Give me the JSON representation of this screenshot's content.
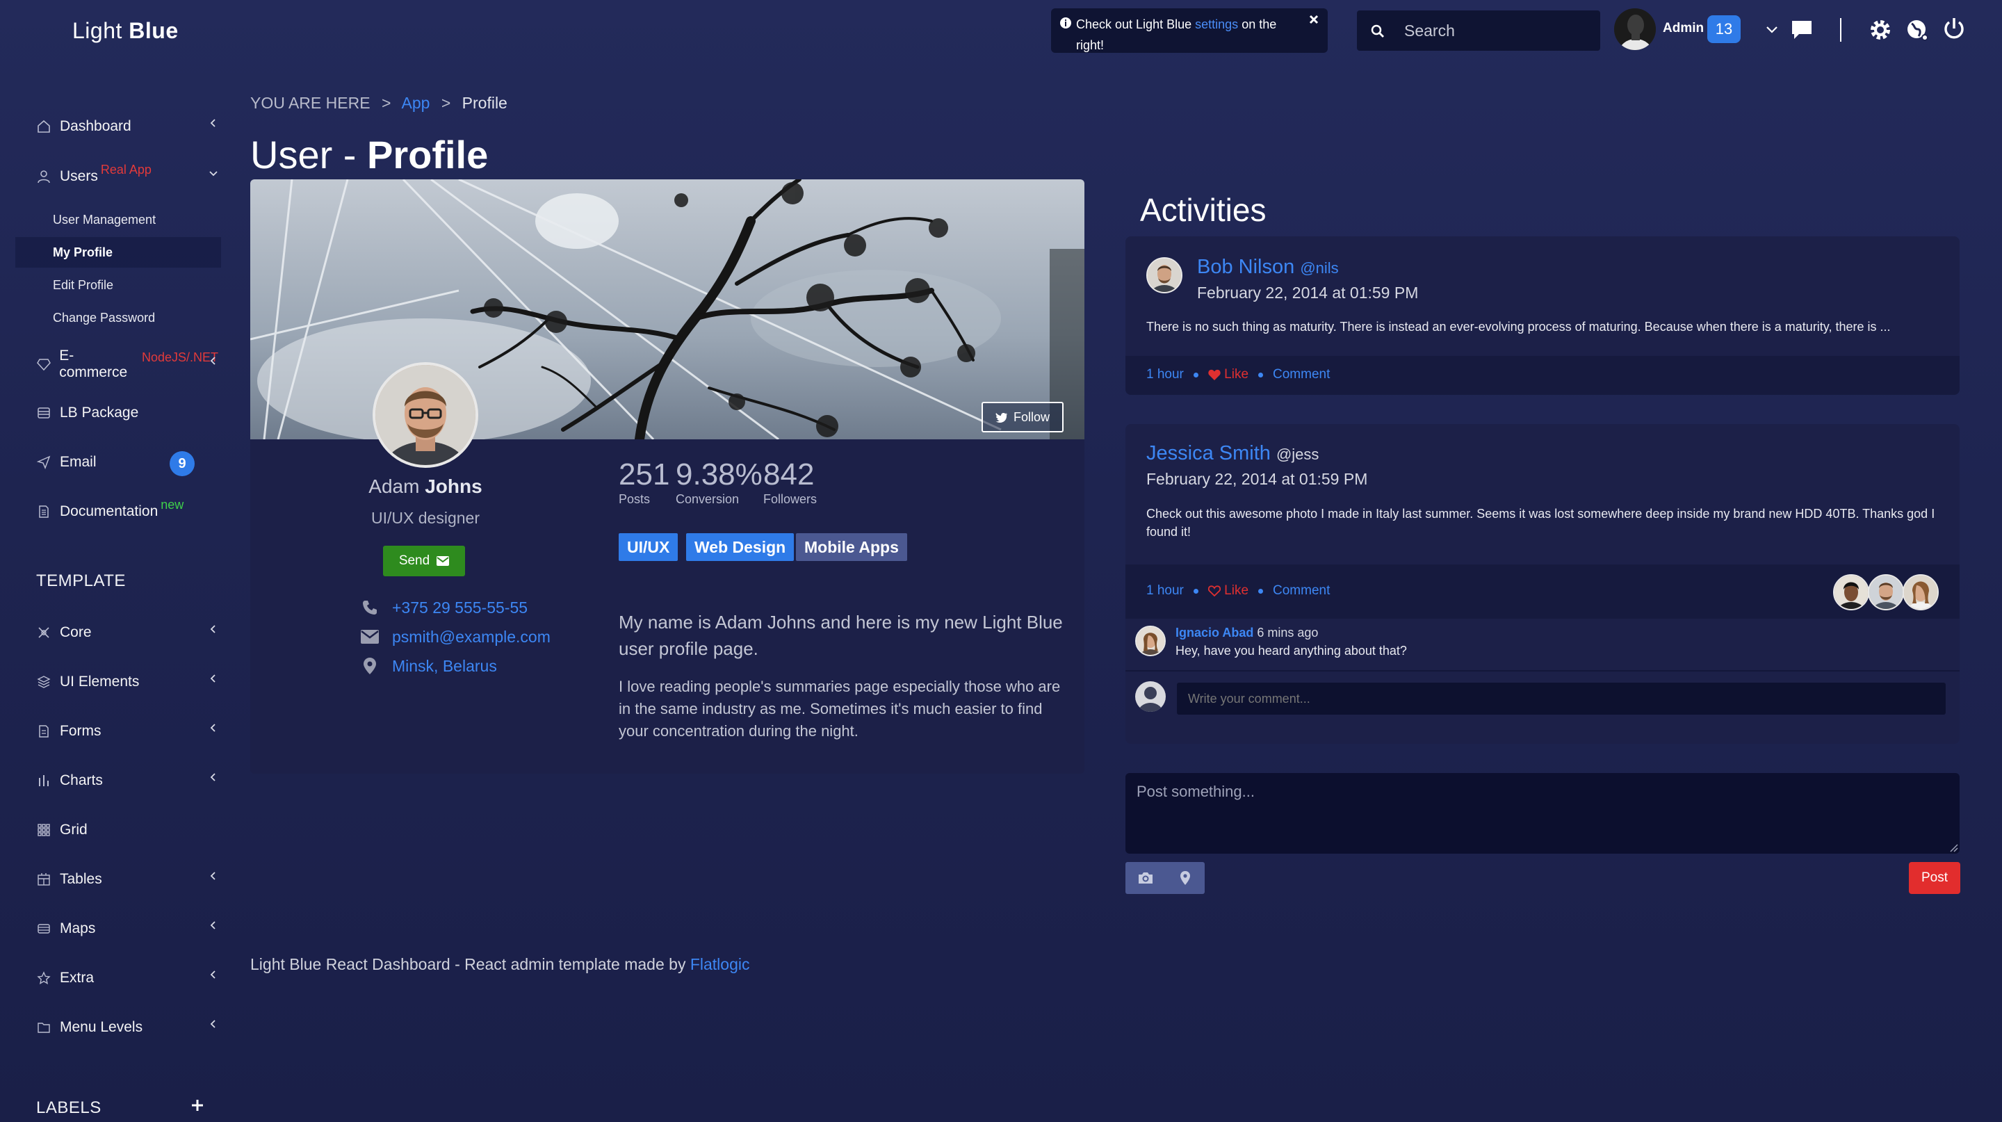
{
  "brand": {
    "light": "Light",
    "bold": "Blue"
  },
  "sidebar": {
    "items": [
      {
        "label": "Dashboard"
      },
      {
        "label": "Users",
        "badge": "Real App"
      },
      {
        "label": "E-commerce",
        "badge": "NodeJS/.NET"
      },
      {
        "label": "LB Package"
      },
      {
        "label": "Email",
        "count": "9"
      },
      {
        "label": "Documentation",
        "badge": "new"
      }
    ],
    "users_sub": [
      "User Management",
      "My Profile",
      "Edit Profile",
      "Change Password"
    ],
    "active_sub": "My Profile",
    "template_title": "TEMPLATE",
    "template_items": [
      "Core",
      "UI Elements",
      "Forms",
      "Charts",
      "Grid",
      "Tables",
      "Maps",
      "Extra",
      "Menu Levels"
    ],
    "labels_title": "LABELS"
  },
  "header": {
    "notice": {
      "before": "Check out Light Blue",
      "link": "settings",
      "after": "on the right!"
    },
    "search_placeholder": "Search",
    "user_name": "Admin",
    "notification_count": "13"
  },
  "breadcrumb": {
    "prefix": "YOU ARE HERE",
    "app": "App",
    "current": "Profile"
  },
  "page_title": {
    "light": "User - ",
    "bold": "Profile"
  },
  "profile": {
    "first_name": "Adam",
    "last_name": "Johns",
    "role": "UI/UX designer",
    "send_label": "Send",
    "follow_label": "Follow",
    "phone": "+375 29 555-55-55",
    "email": "psmith@example.com",
    "location": "Minsk, Belarus",
    "stats": [
      {
        "value": "251",
        "label": "Posts"
      },
      {
        "value": "9.38%",
        "label": "Conversion"
      },
      {
        "value": "842",
        "label": "Followers"
      }
    ],
    "tags": [
      "UI/UX",
      "Web Design",
      "Mobile Apps"
    ],
    "bio_lead": "My name is Adam Johns and here is my new Light Blue user profile page.",
    "bio": "I love reading people's summaries page especially those who are in the same industry as me. Sometimes it's much easier to find your concentration during the night."
  },
  "activities": {
    "title": "Activities",
    "posts": [
      {
        "author": "Bob Nilson",
        "handle": "@nils",
        "date": "February 22, 2014 at 01:59 PM",
        "text": "There is no such thing as maturity. There is instead an ever-evolving process of maturing. Because when there is a maturity, there is ...",
        "time": "1 hour",
        "like": "Like",
        "comment": "Comment"
      },
      {
        "author": "Jessica Smith",
        "handle": "@jess",
        "date": "February 22, 2014 at 01:59 PM",
        "text": "Check out this awesome photo I made in Italy last summer. Seems it was lost somewhere deep inside my brand new HDD 40TB. Thanks god I found it!",
        "time": "1 hour",
        "like": "Like",
        "comment": "Comment",
        "reply": {
          "author": "Ignacio Abad",
          "time": "6 mins ago",
          "text": "Hey, have you heard anything about that?"
        },
        "comment_placeholder": "Write your comment..."
      }
    ],
    "post_placeholder": "Post something...",
    "post_button": "Post"
  },
  "footer": {
    "text": "Light Blue React Dashboard - React admin template made by",
    "link": "Flatlogic"
  }
}
